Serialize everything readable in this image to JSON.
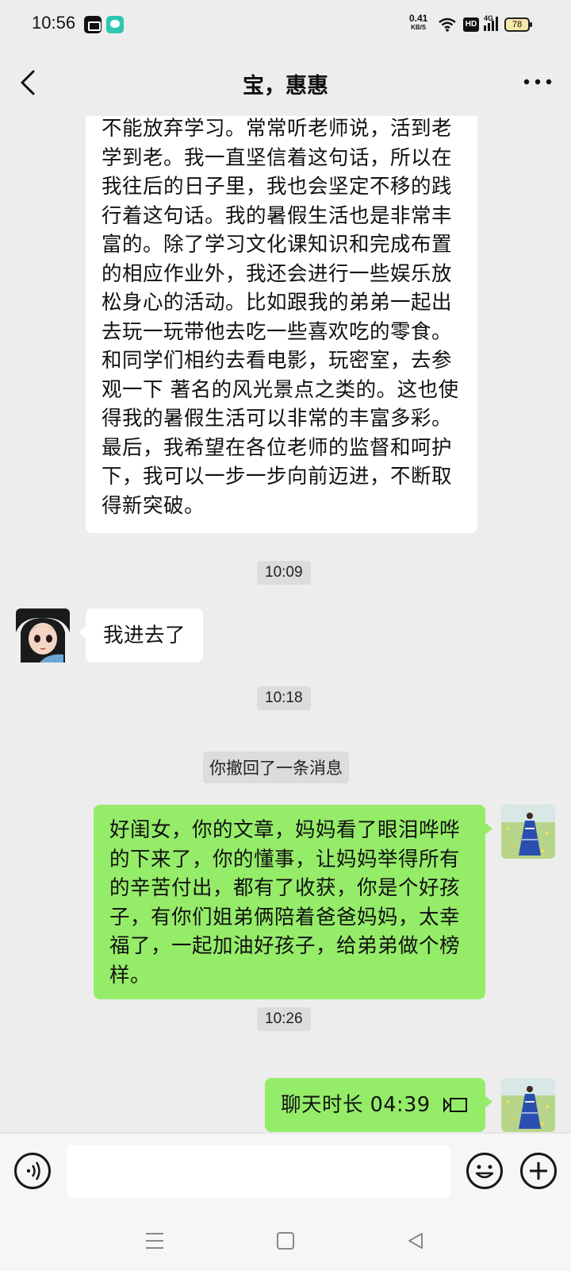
{
  "status_bar": {
    "time": "10:56",
    "net_speed_value": "0.41",
    "net_speed_unit": "KB/S",
    "hd_label": "HD",
    "network_label": "4G",
    "battery_level": "78"
  },
  "header": {
    "title": "宝，惠惠"
  },
  "messages": {
    "long_text": "不能放弃学习。常常听老师说，活到老学到老。我一直坚信着这句话，所以在我往后的日子里，我也会坚定不移的践行着这句话。我的暑假生活也是非常丰富的。除了学习文化课知识和完成布置的相应作业外，我还会进行一些娱乐放松身心的活动。比如跟我的弟弟一起出去玩一玩带他去吃一些喜欢吃的零食。和同学们相约去看电影，玩密室，去参观一下 著名的风光景点之类的。这也使得我的暑假生活可以非常的丰富多彩。最后，我希望在各位老师的监督和呵护下，我可以一步一步向前迈进，不断取得新突破。",
    "time1": "10:09",
    "reply_text": "我进去了",
    "time2": "10:18",
    "recall_note": "你撤回了一条消息",
    "mom_text": "好闺女，你的文章，妈妈看了眼泪哗哗的下来了，你的懂事，让妈妈举得所有的辛苦付出，都有了收获，你是个好孩子，有你们姐弟俩陪着爸爸妈妈，太幸福了，一起加油好孩子，给弟弟做个榜样。",
    "time3": "10:26",
    "call_text": "聊天时长 04:39"
  },
  "input_bar": {
    "placeholder": ""
  },
  "colors": {
    "background": "#ededed",
    "outgoing_bubble": "#95ec69",
    "incoming_bubble": "#ffffff"
  }
}
